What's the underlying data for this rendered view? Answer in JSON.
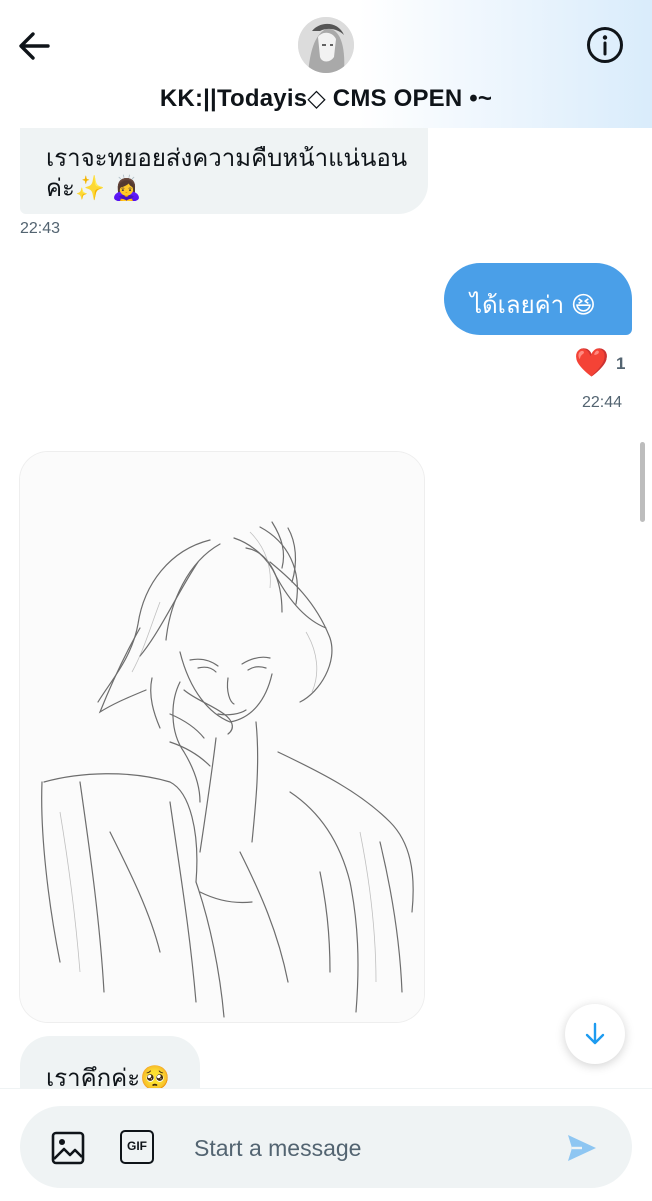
{
  "header": {
    "title": "KK:||Todayis◇ CMS OPEN •~"
  },
  "messages": [
    {
      "side": "incoming",
      "text_line1": "เราจะทยอยส่งความคืบหน้าแน่นอน",
      "text_line2": "ค่ะ✨ 🙇‍♀️",
      "time": "22:43"
    },
    {
      "side": "outgoing",
      "text": "ได้เลยค่า 😆",
      "reaction": "❤️",
      "reaction_count": "1",
      "time": "22:44"
    },
    {
      "side": "incoming",
      "type": "image",
      "image_icon": "pencil-sketch-portrait"
    },
    {
      "side": "incoming",
      "text": "เราคึกค่ะ🥺"
    }
  ],
  "composer": {
    "placeholder": "Start a message",
    "gif_label": "GIF"
  },
  "colors": {
    "accent": "#1d9bf0",
    "outgoing_bubble": "#4a9fe8",
    "incoming_bubble": "#eff3f4",
    "muted_text": "#536471"
  }
}
